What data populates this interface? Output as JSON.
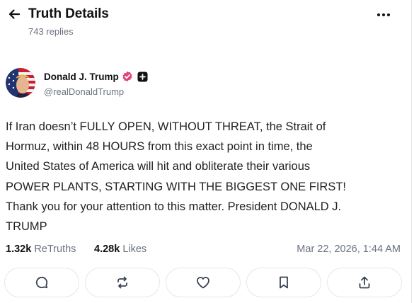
{
  "header": {
    "title": "Truth Details",
    "replies": "743 replies",
    "back_icon": "arrow-left-icon",
    "more_icon": "more-horizontal-icon"
  },
  "author": {
    "name": "Donald J. Trump",
    "handle": "@realDonaldTrump",
    "verified_color": "#e0457b",
    "badges": [
      "verified-badge-icon",
      "plus-badge-icon"
    ]
  },
  "post": {
    "lines": [
      "If Iran doesn’t FULLY OPEN, WITHOUT THREAT, the Strait of",
      "Hormuz, within 48 HOURS from this exact point in time, the",
      "United States of America will hit and obliterate their various",
      "POWER PLANTS, STARTING WITH THE BIGGEST ONE FIRST!",
      "Thank you for your attention to this matter. President DONALD J.",
      "TRUMP"
    ]
  },
  "stats": {
    "retruths_count": "1.32k",
    "retruths_label": "ReTruths",
    "likes_count": "4.28k",
    "likes_label": "Likes",
    "timestamp": "Mar 22, 2026, 1:44 AM"
  },
  "actions": [
    {
      "name": "reply-button",
      "icon": "comment-icon"
    },
    {
      "name": "retruth-button",
      "icon": "repost-icon"
    },
    {
      "name": "like-button",
      "icon": "heart-icon"
    },
    {
      "name": "bookmark-button",
      "icon": "bookmark-icon"
    },
    {
      "name": "share-button",
      "icon": "share-icon"
    }
  ]
}
